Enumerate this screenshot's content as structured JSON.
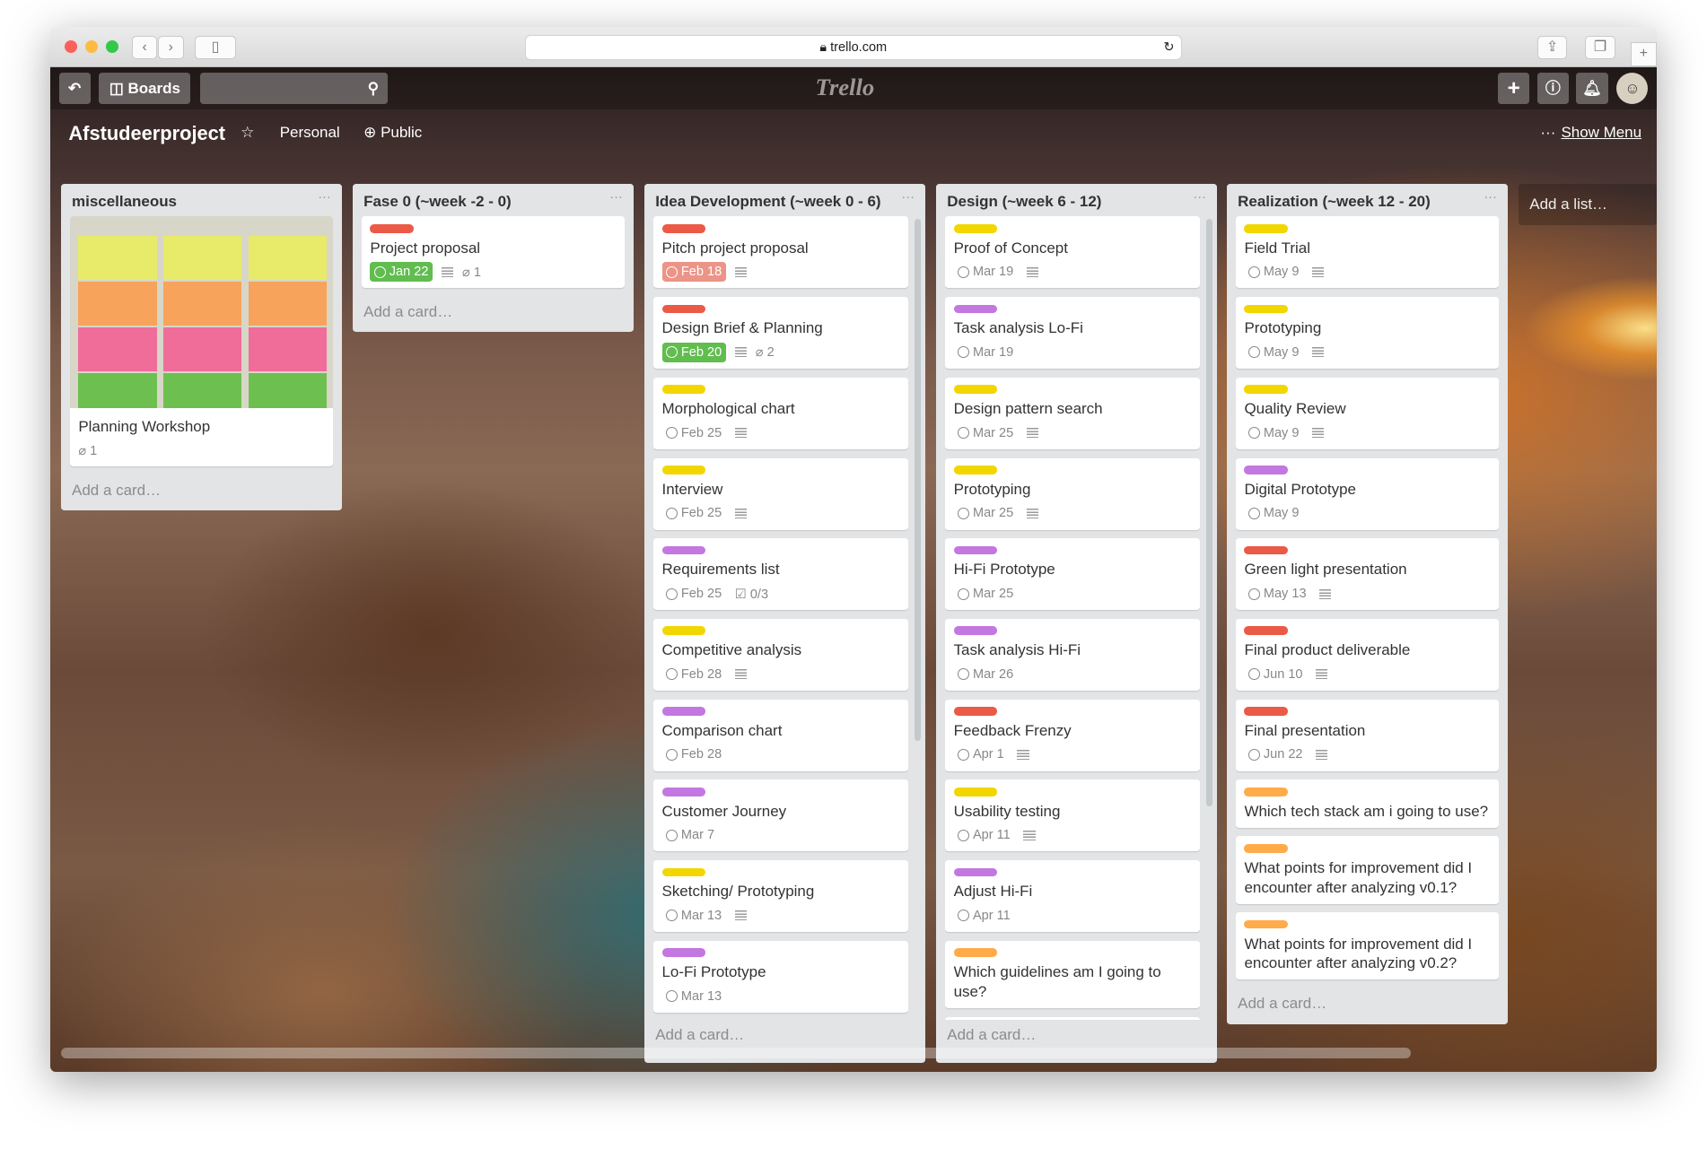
{
  "browser": {
    "url": "trello.com",
    "icons": [
      "back-icon",
      "forward-icon",
      "sidebar-icon",
      "lock-icon",
      "reload-icon",
      "share-icon",
      "tabs-icon",
      "new-tab-icon"
    ]
  },
  "header": {
    "boards_label": "Boards",
    "search_value": "",
    "logo": "Trello"
  },
  "board": {
    "title": "Afstudeerproject",
    "team": "Personal",
    "visibility": "Public",
    "show_menu": "Show Menu",
    "add_list": "Add a list…"
  },
  "colors": {
    "red": "#eb5a46",
    "yellow": "#f2d600",
    "purple": "#c377e0",
    "orange": "#ffab4a",
    "green": "#61bd4f"
  },
  "add_card": "Add a card…",
  "lists": [
    {
      "title": "miscellaneous",
      "cards": [
        {
          "title": "Planning Workshop",
          "cover": true,
          "attachments": "1"
        }
      ]
    },
    {
      "title": "Fase 0 (~week -2 - 0)",
      "cards": [
        {
          "label": "red",
          "title": "Project proposal",
          "due": "Jan 22",
          "due_state": "green",
          "desc": true,
          "attachments": "1"
        }
      ]
    },
    {
      "title": "Idea Development (~week 0 - 6)",
      "cards": [
        {
          "label": "red",
          "title": "Pitch project proposal",
          "due": "Feb 18",
          "due_state": "red",
          "desc": true
        },
        {
          "label": "red",
          "title": "Design Brief & Planning",
          "due": "Feb 20",
          "due_state": "green",
          "desc": true,
          "attachments": "2"
        },
        {
          "label": "yellow",
          "title": "Morphological chart",
          "due": "Feb 25",
          "desc": true
        },
        {
          "label": "yellow",
          "title": "Interview",
          "due": "Feb 25",
          "desc": true
        },
        {
          "label": "purple",
          "title": "Requirements list",
          "due": "Feb 25",
          "checklist": "0/3"
        },
        {
          "label": "yellow",
          "title": "Competitive analysis",
          "due": "Feb 28",
          "desc": true
        },
        {
          "label": "purple",
          "title": "Comparison chart",
          "due": "Feb 28"
        },
        {
          "label": "purple",
          "title": "Customer Journey",
          "due": "Mar 7"
        },
        {
          "label": "yellow",
          "title": "Sketching/ Prototyping",
          "due": "Mar 13",
          "desc": true
        },
        {
          "label": "purple",
          "title": "Lo-Fi Prototype",
          "due": "Mar 13"
        }
      ]
    },
    {
      "title": "Design (~week 6 - 12)",
      "cards": [
        {
          "label": "yellow",
          "title": "Proof of Concept",
          "due": "Mar 19",
          "desc": true
        },
        {
          "label": "purple",
          "title": "Task analysis Lo-Fi",
          "due": "Mar 19"
        },
        {
          "label": "yellow",
          "title": "Design pattern search",
          "due": "Mar 25",
          "desc": true
        },
        {
          "label": "yellow",
          "title": "Prototyping",
          "due": "Mar 25",
          "desc": true
        },
        {
          "label": "purple",
          "title": "Hi-Fi Prototype",
          "due": "Mar 25"
        },
        {
          "label": "purple",
          "title": "Task analysis Hi-Fi",
          "due": "Mar 26"
        },
        {
          "label": "red",
          "title": "Feedback Frenzy",
          "due": "Apr 1",
          "desc": true
        },
        {
          "label": "yellow",
          "title": "Usability testing",
          "due": "Apr 11",
          "desc": true
        },
        {
          "label": "purple",
          "title": "Adjust Hi-Fi",
          "due": "Apr 11"
        },
        {
          "label": "orange",
          "title": "Which guidelines am I going to use?"
        },
        {
          "label": "orange",
          "title": ""
        }
      ]
    },
    {
      "title": "Realization (~week 12 - 20)",
      "cards": [
        {
          "label": "yellow",
          "title": "Field Trial",
          "due": "May 9",
          "desc": true
        },
        {
          "label": "yellow",
          "title": "Prototyping",
          "due": "May 9",
          "desc": true
        },
        {
          "label": "yellow",
          "title": "Quality Review",
          "due": "May 9",
          "desc": true
        },
        {
          "label": "purple",
          "title": "Digital Prototype",
          "due": "May 9"
        },
        {
          "label": "red",
          "title": "Green light presentation",
          "due": "May 13",
          "desc": true
        },
        {
          "label": "red",
          "title": "Final product deliverable",
          "due": "Jun 10",
          "desc": true
        },
        {
          "label": "red",
          "title": "Final presentation",
          "due": "Jun 22",
          "desc": true
        },
        {
          "label": "orange",
          "title": "Which tech stack am i going to use?"
        },
        {
          "label": "orange",
          "title": "What points for improvement did I encounter after analyzing v0.1?"
        },
        {
          "label": "orange",
          "title": "What points for improvement did I encounter after analyzing v0.2?"
        }
      ]
    }
  ]
}
